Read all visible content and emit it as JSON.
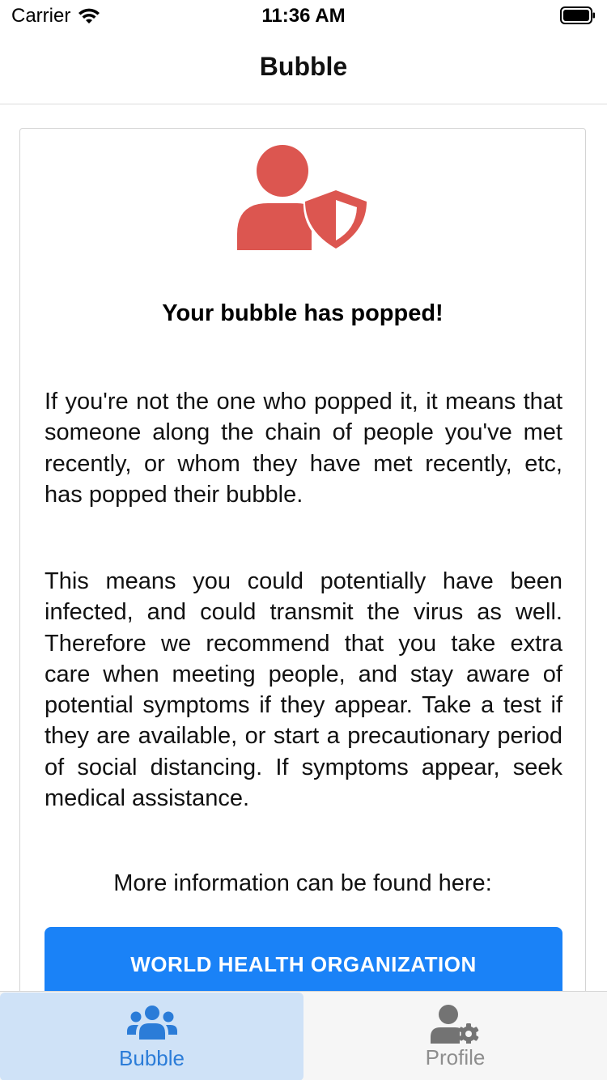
{
  "status_bar": {
    "carrier": "Carrier",
    "time": "11:36 AM",
    "wifi_icon": "wifi-icon",
    "battery_icon": "battery-full-icon"
  },
  "nav": {
    "title": "Bubble"
  },
  "card": {
    "icon": "user-shield-icon",
    "icon_color": "#dc5650",
    "headline": "Your bubble has popped!",
    "paragraph_1": "If you're not the one who popped it, it means that someone along the chain of people you've met recently, or whom they have met recently, etc, has popped their bubble.",
    "paragraph_2": "This means you could potentially have been infected, and could transmit the virus as well. Therefore we recommend that you take extra care when meeting people, and stay aware of potential symptoms if they appear. Take a test if they are available, or start a precautionary period of social distancing. If symptoms appear, seek medical assistance.",
    "more_info": "More information can be found here:",
    "button_label": "WORLD HEALTH ORGANIZATION",
    "button_color": "#1a82f7"
  },
  "tab_bar": {
    "tabs": [
      {
        "label": "Bubble",
        "icon": "users-icon",
        "active": true,
        "color": "#2b7cd8"
      },
      {
        "label": "Profile",
        "icon": "user-cog-icon",
        "active": false,
        "color": "#8e8e8e"
      }
    ]
  }
}
